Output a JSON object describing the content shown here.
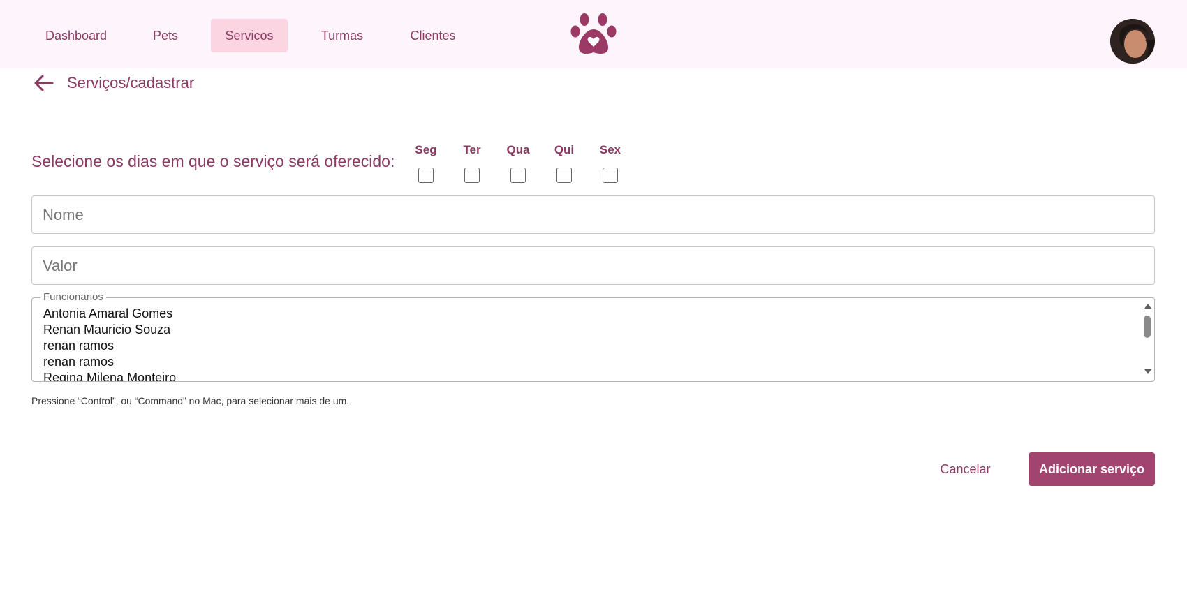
{
  "nav": {
    "items": [
      {
        "label": "Dashboard"
      },
      {
        "label": "Pets"
      },
      {
        "label": "Servicos",
        "active": true
      },
      {
        "label": "Turmas"
      },
      {
        "label": "Clientes"
      }
    ]
  },
  "logo": {
    "icon": "paw-heart-icon"
  },
  "user": {
    "avatar": "user-avatar"
  },
  "breadcrumb": "Serviços/cadastrar",
  "days": {
    "label": "Selecione os dias em que o serviço será oferecido:",
    "options": [
      "Seg",
      "Ter",
      "Qua",
      "Qui",
      "Sex"
    ]
  },
  "form": {
    "name_placeholder": "Nome",
    "value_placeholder": "Valor",
    "staff": {
      "legend": "Funcionarios",
      "options": [
        "Antonia Amaral Gomes",
        "Renan Mauricio Souza",
        "renan ramos",
        "renan ramos",
        "Regina Milena Monteiro"
      ]
    },
    "hint": "Pressione “Control”, ou “Command” no Mac, para selecionar mais de um."
  },
  "actions": {
    "cancel": "Cancelar",
    "submit": "Adicionar serviço"
  },
  "colors": {
    "accent": "#8c3a63",
    "button": "#a24470",
    "nav_active_bg": "#fbd5e2",
    "topbar_bg": "#fdf5fb"
  }
}
